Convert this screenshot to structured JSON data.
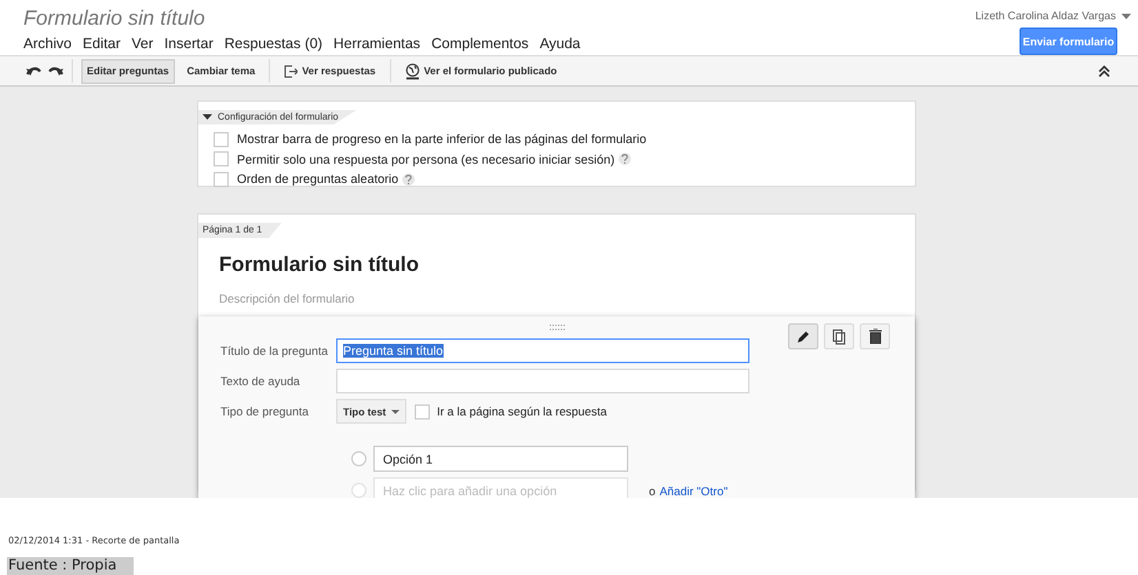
{
  "document": {
    "title": "Formulario sin título",
    "user": "Lizeth Carolina Aldaz Vargas",
    "send_button": "Enviar formulario"
  },
  "menu": [
    "Archivo",
    "Editar",
    "Ver",
    "Insertar",
    "Respuestas (0)",
    "Herramientas",
    "Complementos",
    "Ayuda"
  ],
  "toolbar": [
    {
      "label": "Editar preguntas",
      "kind": "text",
      "selected": true
    },
    {
      "label": "Cambiar tema",
      "kind": "text",
      "selected": false
    },
    {
      "label": "Ver respuestas",
      "kind": "export",
      "selected": false
    },
    {
      "label": "Ver el formulario publicado",
      "kind": "globe",
      "selected": false
    }
  ],
  "settings": {
    "header": "Configuración del formulario",
    "expanded": true,
    "options": [
      {
        "label": "Mostrar barra de progreso en la parte inferior de las páginas del formulario",
        "checked": false,
        "help": false
      },
      {
        "label": "Permitir solo una respuesta por persona (es necesario iniciar sesión)",
        "checked": false,
        "help": true
      },
      {
        "label": "Orden de preguntas aleatorio",
        "checked": false,
        "help": true
      }
    ]
  },
  "page": {
    "label": "Página 1 de 1",
    "form_title": "Formulario sin título",
    "description_placeholder": "Descripción del formulario"
  },
  "question": {
    "title_label": "Título de la pregunta",
    "title_value": "Pregunta sin título",
    "help_label": "Texto de ayuda",
    "type_label": "Tipo de pregunta",
    "type_value": "Tipo test",
    "goto_label": "Ir a la página según la respuesta",
    "goto_checked": false,
    "options": [
      {
        "value": "Opción 1",
        "checked": false
      }
    ],
    "add_checked": false,
    "add_placeholder": "Haz clic para añadir una opción",
    "add_other_prefix": "o",
    "add_other_link": "Añadir \"Otro\""
  },
  "caption": "02/12/2014 1:31 - Recorte de pantalla",
  "source": "Fuente : Propia"
}
